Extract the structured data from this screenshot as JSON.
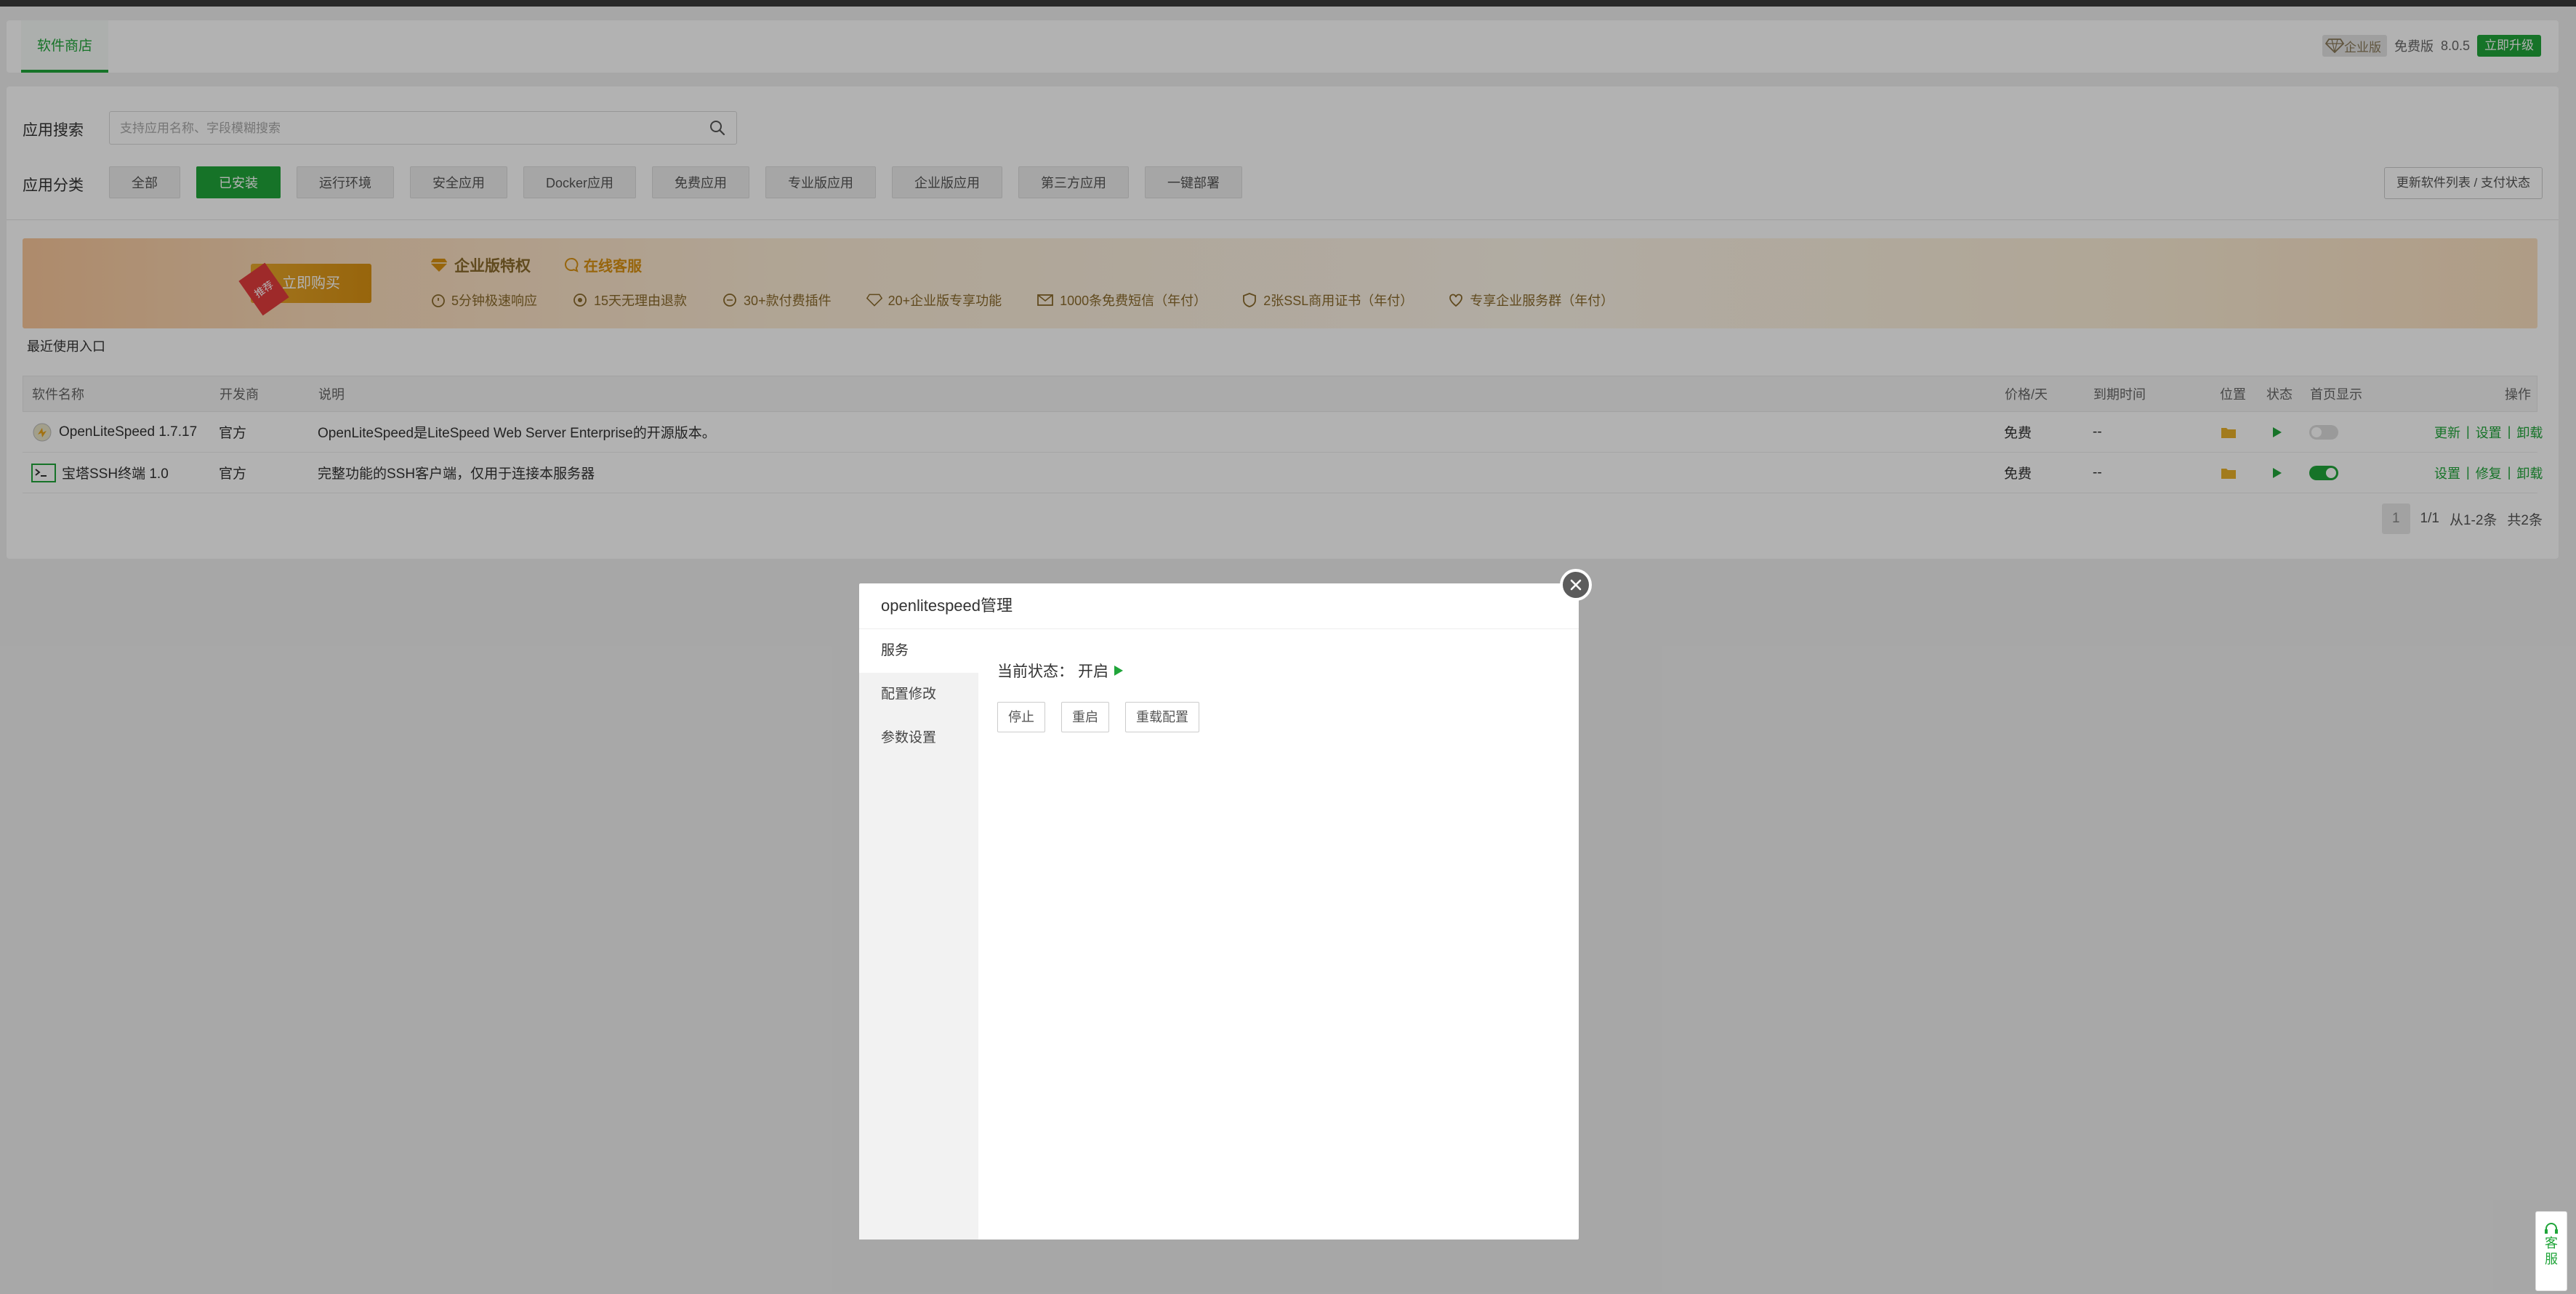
{
  "header": {
    "tab_label": "软件商店",
    "edition_badge": "企业版",
    "free_label": "免费版",
    "version": "8.0.5",
    "upgrade_label": "立即升级"
  },
  "search": {
    "label": "应用搜索",
    "placeholder": "支持应用名称、字段模糊搜索",
    "value": ""
  },
  "categories": {
    "label": "应用分类",
    "items": [
      "全部",
      "已安装",
      "运行环境",
      "安全应用",
      "Docker应用",
      "免费应用",
      "专业版应用",
      "企业版应用",
      "第三方应用",
      "一键部署"
    ],
    "active_index": 1,
    "refresh_label": "更新软件列表 / 支付状态"
  },
  "banner": {
    "tag": "推荐",
    "buy_label": "立即购买",
    "title": "企业版特权",
    "cs_label": "在线客服",
    "features": [
      "5分钟极速响应",
      "15天无理由退款",
      "30+款付费插件",
      "20+企业版专享功能",
      "1000条免费短信（年付）",
      "2张SSL商用证书（年付）",
      "专享企业服务群（年付）"
    ]
  },
  "recent_label": "最近使用入口",
  "table": {
    "headers": {
      "name": "软件名称",
      "developer": "开发商",
      "desc": "说明",
      "price": "价格/天",
      "expire": "到期时间",
      "location": "位置",
      "status": "状态",
      "homepage": "首页显示",
      "ops": "操作"
    },
    "rows": [
      {
        "name": "OpenLiteSpeed 1.7.17",
        "developer": "官方",
        "desc": "OpenLiteSpeed是LiteSpeed Web Server Enterprise的开源版本。",
        "price": "免费",
        "expire": "--",
        "homepage_on": false,
        "ops": [
          "更新",
          "设置",
          "卸载"
        ]
      },
      {
        "name": "宝塔SSH终端 1.0",
        "developer": "官方",
        "desc": "完整功能的SSH客户端，仅用于连接本服务器",
        "price": "免费",
        "expire": "--",
        "homepage_on": true,
        "ops": [
          "设置",
          "修复",
          "卸载"
        ]
      }
    ]
  },
  "pagination": {
    "current": "1",
    "pages": "1/1",
    "range": "从1-2条",
    "total": "共2条"
  },
  "modal": {
    "title": "openlitespeed管理",
    "tabs": [
      "服务",
      "配置修改",
      "参数设置"
    ],
    "active_tab": 0,
    "status_label": "当前状态：",
    "status_value": "开启",
    "buttons": [
      "停止",
      "重启",
      "重载配置"
    ]
  },
  "support": {
    "label_line1": "客",
    "label_line2": "服"
  },
  "colors": {
    "accent": "#20a53a",
    "overlay": "rgba(0,0,0,0.3)",
    "gold": "#d99112"
  }
}
